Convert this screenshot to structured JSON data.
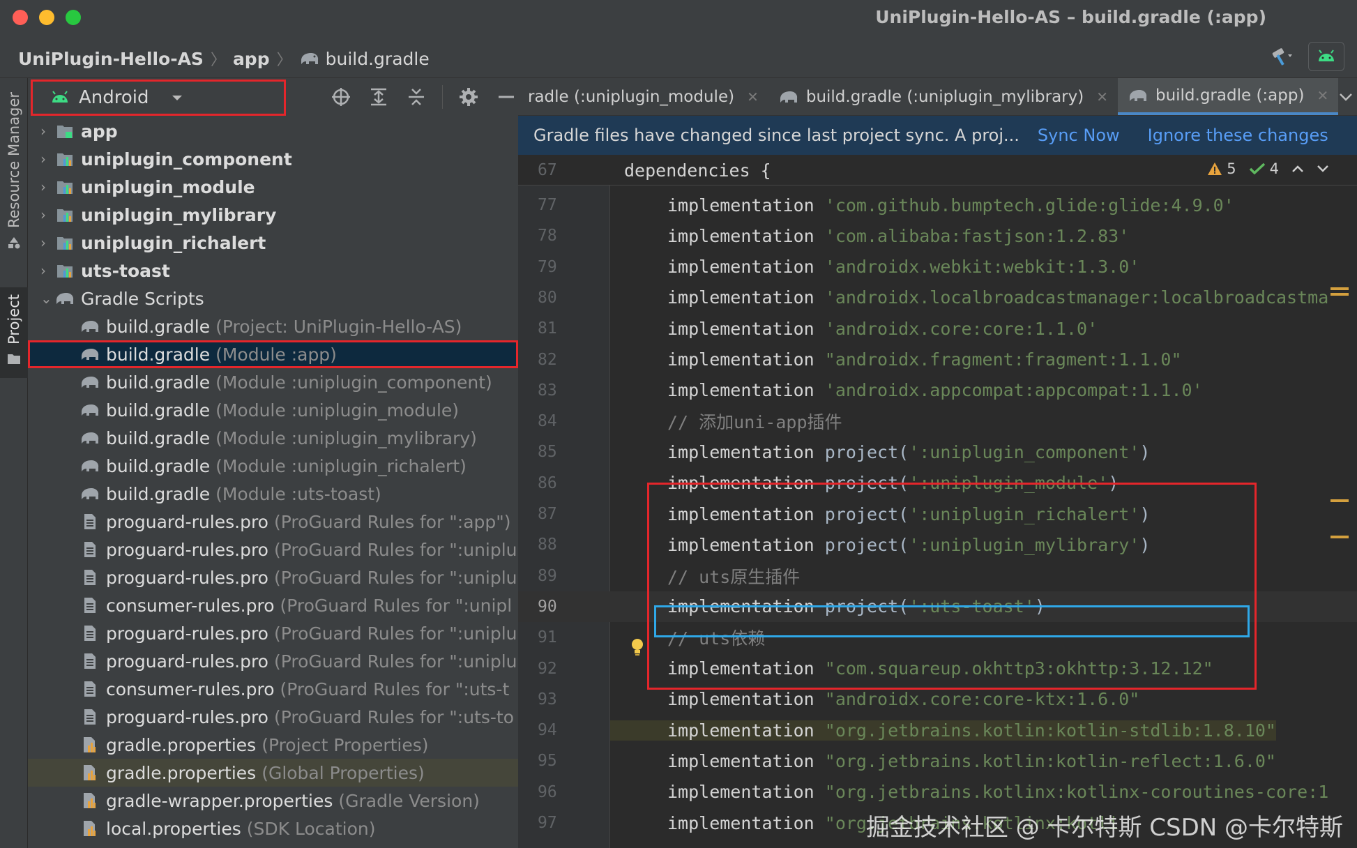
{
  "window": {
    "title": "UniPlugin-Hello-AS – build.gradle (:app)"
  },
  "breadcrumb": {
    "items": [
      "UniPlugin-Hello-AS",
      "app",
      "build.gradle"
    ]
  },
  "toolstrip": {
    "resource_manager": "Resource Manager",
    "project": "Project"
  },
  "project_panel": {
    "view_mode": "Android",
    "tree": [
      {
        "name": "app",
        "hint": "",
        "bold": true,
        "kind": "module-app",
        "expanded": false
      },
      {
        "name": "uniplugin_component",
        "hint": "",
        "bold": true,
        "kind": "module",
        "expanded": false
      },
      {
        "name": "uniplugin_module",
        "hint": "",
        "bold": true,
        "kind": "module",
        "expanded": false
      },
      {
        "name": "uniplugin_mylibrary",
        "hint": "",
        "bold": true,
        "kind": "module",
        "expanded": false
      },
      {
        "name": "uniplugin_richalert",
        "hint": "",
        "bold": true,
        "kind": "module",
        "expanded": false
      },
      {
        "name": "uts-toast",
        "hint": "",
        "bold": true,
        "kind": "module",
        "expanded": false
      },
      {
        "name": "Gradle Scripts",
        "hint": "",
        "bold": false,
        "kind": "gradle-group",
        "expanded": true
      },
      {
        "name": "build.gradle",
        "hint": "(Project: UniPlugin-Hello-AS)",
        "kind": "gradle"
      },
      {
        "name": "build.gradle",
        "hint": "(Module :app)",
        "kind": "gradle",
        "selected": true
      },
      {
        "name": "build.gradle",
        "hint": "(Module :uniplugin_component)",
        "kind": "gradle"
      },
      {
        "name": "build.gradle",
        "hint": "(Module :uniplugin_module)",
        "kind": "gradle"
      },
      {
        "name": "build.gradle",
        "hint": "(Module :uniplugin_mylibrary)",
        "kind": "gradle"
      },
      {
        "name": "build.gradle",
        "hint": "(Module :uniplugin_richalert)",
        "kind": "gradle"
      },
      {
        "name": "build.gradle",
        "hint": "(Module :uts-toast)",
        "kind": "gradle"
      },
      {
        "name": "proguard-rules.pro",
        "hint": "(ProGuard Rules for \":app\")",
        "kind": "file"
      },
      {
        "name": "proguard-rules.pro",
        "hint": "(ProGuard Rules for \":uniplu",
        "kind": "file"
      },
      {
        "name": "proguard-rules.pro",
        "hint": "(ProGuard Rules for \":uniplu",
        "kind": "file"
      },
      {
        "name": "consumer-rules.pro",
        "hint": "(ProGuard Rules for \":unipl",
        "kind": "file"
      },
      {
        "name": "proguard-rules.pro",
        "hint": "(ProGuard Rules for \":uniplu",
        "kind": "file"
      },
      {
        "name": "proguard-rules.pro",
        "hint": "(ProGuard Rules for \":uniplu",
        "kind": "file"
      },
      {
        "name": "consumer-rules.pro",
        "hint": "(ProGuard Rules for \":uts-t",
        "kind": "file"
      },
      {
        "name": "proguard-rules.pro",
        "hint": "(ProGuard Rules for \":uts-to",
        "kind": "file"
      },
      {
        "name": "gradle.properties",
        "hint": "(Project Properties)",
        "kind": "props"
      },
      {
        "name": "gradle.properties",
        "hint": "(Global Properties)",
        "kind": "props",
        "highlight": true
      },
      {
        "name": "gradle-wrapper.properties",
        "hint": "(Gradle Version)",
        "kind": "props"
      },
      {
        "name": "local.properties",
        "hint": "(SDK Location)",
        "kind": "props"
      }
    ]
  },
  "editor": {
    "tabs": [
      {
        "label": "radle (:uniplugin_module)",
        "active": false
      },
      {
        "label": "build.gradle (:uniplugin_mylibrary)",
        "active": false
      },
      {
        "label": "build.gradle (:app)",
        "active": true
      }
    ],
    "banner": {
      "message": "Gradle files have changed since last project sync. A proj...",
      "sync_now": "Sync Now",
      "ignore": "Ignore these changes"
    },
    "inspections": {
      "warnings": "5",
      "weak_warnings": "4"
    },
    "sticky": {
      "line": "67",
      "text": "dependencies {"
    },
    "lines": [
      {
        "n": "77",
        "kw": "implementation",
        "arg": "'com.github.bumptech.glide:glide:4.9.0'",
        "type": "str"
      },
      {
        "n": "78",
        "kw": "implementation",
        "arg": "'com.alibaba:fastjson:1.2.83'",
        "type": "str"
      },
      {
        "n": "79",
        "kw": "implementation",
        "arg": "'androidx.webkit:webkit:1.3.0'",
        "type": "str"
      },
      {
        "n": "80",
        "kw": "implementation",
        "arg": "'androidx.localbroadcastmanager:localbroadcastma",
        "type": "str"
      },
      {
        "n": "81",
        "kw": "implementation",
        "arg": "'androidx.core:core:1.1.0'",
        "type": "str"
      },
      {
        "n": "82",
        "kw": "implementation",
        "arg": "\"androidx.fragment:fragment:1.1.0\"",
        "type": "str"
      },
      {
        "n": "83",
        "kw": "implementation",
        "arg": "'androidx.appcompat:appcompat:1.1.0'",
        "type": "str"
      },
      {
        "n": "84",
        "kw": "",
        "arg": "// 添加uni-app插件",
        "type": "cmt"
      },
      {
        "n": "85",
        "kw": "implementation",
        "arg": "project(':uniplugin_component')",
        "type": "proj"
      },
      {
        "n": "86",
        "kw": "implementation",
        "arg": "project(':uniplugin_module')",
        "type": "proj"
      },
      {
        "n": "87",
        "kw": "implementation",
        "arg": "project(':uniplugin_richalert')",
        "type": "proj"
      },
      {
        "n": "88",
        "kw": "implementation",
        "arg": "project(':uniplugin_mylibrary')",
        "type": "proj"
      },
      {
        "n": "89",
        "kw": "",
        "arg": "// uts原生插件",
        "type": "cmt"
      },
      {
        "n": "90",
        "kw": "implementation",
        "arg": "project(':uts-toast')",
        "type": "proj-cur"
      },
      {
        "n": "91",
        "kw": "",
        "arg": "// uts依赖",
        "type": "cmt"
      },
      {
        "n": "92",
        "kw": "implementation",
        "arg": "\"com.squareup.okhttp3:okhttp:3.12.12\"",
        "type": "str"
      },
      {
        "n": "93",
        "kw": "implementation",
        "arg": "\"androidx.core:core-ktx:1.6.0\"",
        "type": "str"
      },
      {
        "n": "94",
        "kw": "implementation",
        "arg": "\"org.jetbrains.kotlin:kotlin-stdlib:1.8.10\"",
        "type": "str-hl"
      },
      {
        "n": "95",
        "kw": "implementation",
        "arg": "\"org.jetbrains.kotlin:kotlin-reflect:1.6.0\"",
        "type": "str"
      },
      {
        "n": "96",
        "kw": "implementation",
        "arg": "\"org.jetbrains.kotlinx:kotlinx-coroutines-core:1",
        "type": "str"
      },
      {
        "n": "97",
        "kw": "implementation",
        "arg": "\"org.jetbrains.kotlinx:kotli",
        "type": "str"
      }
    ]
  },
  "watermark": "掘金技术社区 @ 卡尔特斯 CSDN @卡尔特斯",
  "colors": {
    "annotation_red": "#e4262b",
    "annotation_blue": "#2fa8e8",
    "selection": "#0d293e",
    "link": "#589df6"
  }
}
